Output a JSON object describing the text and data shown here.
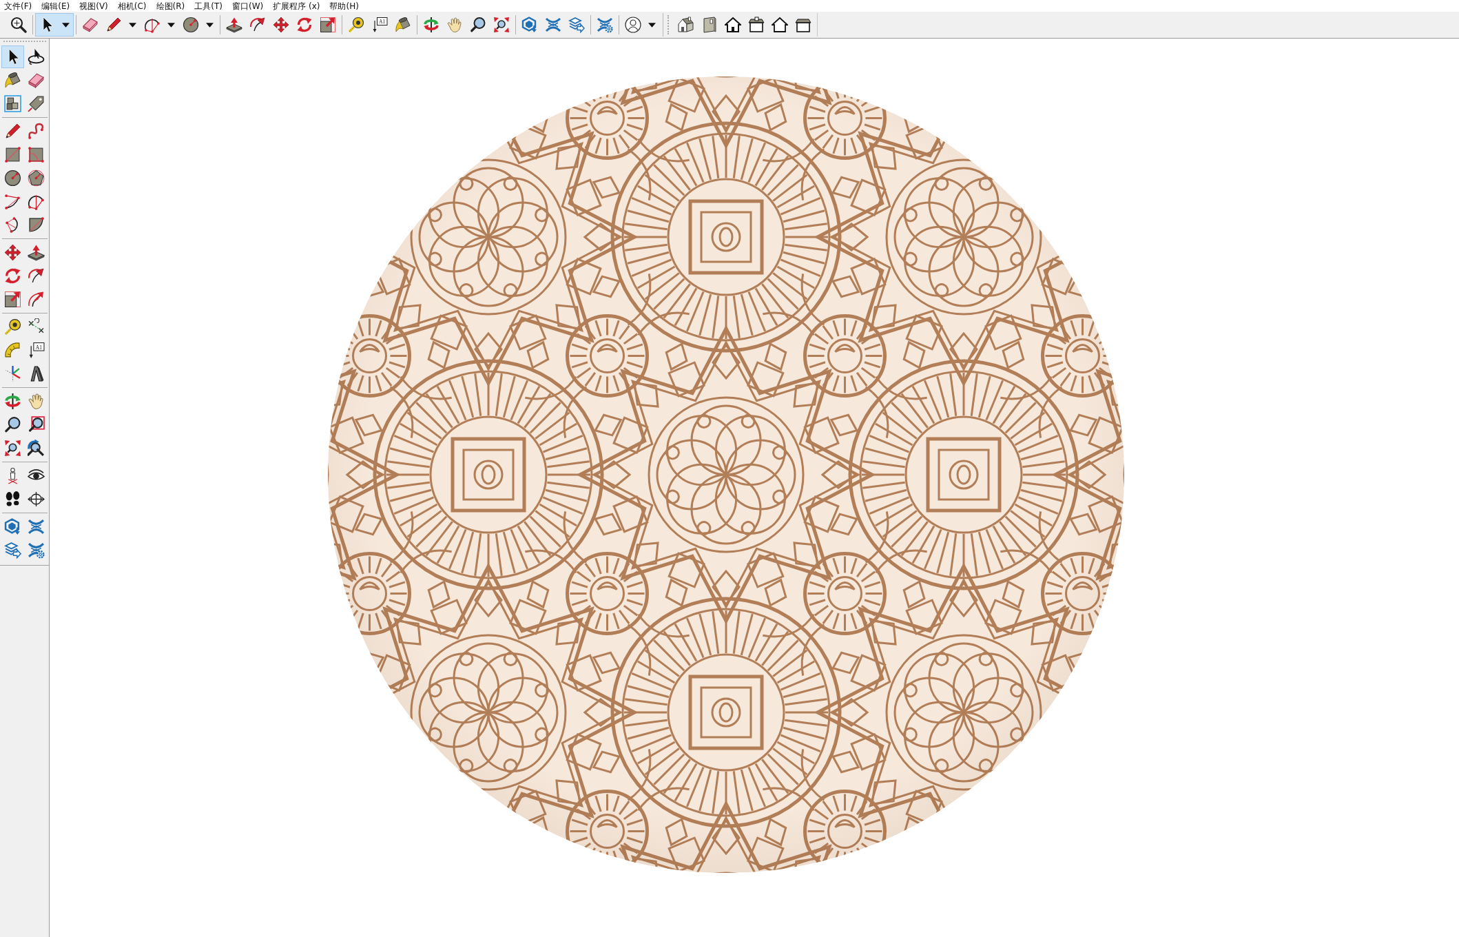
{
  "menu_bar": [
    "文件(F)",
    "编辑(E)",
    "视图(V)",
    "相机(C)",
    "绘图(R)",
    "工具(T)",
    "窗口(W)",
    "扩展程序 (x)",
    "帮助(H)"
  ],
  "toolbars": [
    {
      "groups": [
        [
          {
            "selected": false,
            "dropdown": false
          }
        ],
        [
          {
            "selected": true,
            "dropdown": true
          }
        ],
        [
          {
            "selected": false,
            "dropdown": false
          },
          {
            "selected": false,
            "dropdown": true
          },
          {
            "selected": false,
            "dropdown": true
          },
          {
            "selected": false,
            "dropdown": true
          }
        ],
        [
          {
            "selected": false,
            "dropdown": false
          },
          {
            "selected": false,
            "dropdown": false
          },
          {
            "selected": false,
            "dropdown": false
          },
          {
            "selected": false,
            "dropdown": false
          },
          {
            "selected": false,
            "dropdown": false
          }
        ],
        [
          {
            "selected": false,
            "dropdown": false
          },
          {
            "selected": false,
            "dropdown": false,
            "icon_text": "A1"
          },
          {
            "selected": false,
            "dropdown": false
          }
        ],
        [
          {
            "selected": false,
            "dropdown": false
          },
          {
            "selected": false,
            "dropdown": false
          },
          {
            "selected": false,
            "dropdown": false
          },
          {
            "selected": false,
            "dropdown": false
          }
        ],
        [
          {
            "selected": false,
            "dropdown": false
          },
          {
            "selected": false,
            "dropdown": false
          },
          {
            "selected": false,
            "dropdown": false
          }
        ],
        [
          {
            "selected": false,
            "dropdown": false
          }
        ],
        [
          {
            "selected": false,
            "dropdown": true
          }
        ]
      ]
    },
    {
      "groups": [
        [
          {
            "selected": false,
            "dropdown": false
          },
          {
            "selected": false,
            "dropdown": false
          },
          {
            "selected": false,
            "dropdown": false
          },
          {
            "selected": false,
            "dropdown": false
          },
          {
            "selected": false,
            "dropdown": false
          },
          {
            "selected": false,
            "dropdown": false
          }
        ]
      ]
    }
  ],
  "left_toolbar": {
    "groups": [
      [
        {
          "selected": true
        },
        {
          "selected": false
        },
        {
          "selected": false
        },
        {
          "selected": false
        },
        {
          "selected": false
        },
        {
          "selected": false
        }
      ],
      [
        {
          "selected": false
        },
        {
          "selected": false
        },
        {
          "selected": false
        },
        {
          "selected": false
        },
        {
          "selected": false
        },
        {
          "selected": false
        },
        {
          "selected": false
        },
        {
          "selected": false
        },
        {
          "selected": false
        },
        {
          "selected": false
        }
      ],
      [
        {
          "selected": false
        },
        {
          "selected": false
        },
        {
          "selected": false
        },
        {
          "selected": false
        },
        {
          "selected": false
        },
        {
          "selected": false
        }
      ],
      [
        {
          "selected": false
        },
        {
          "selected": false
        },
        {
          "selected": false
        },
        {
          "selected": false,
          "icon_text": "A1"
        },
        {
          "selected": false
        },
        {
          "selected": false
        }
      ],
      [
        {
          "selected": false
        },
        {
          "selected": false
        },
        {
          "selected": false
        },
        {
          "selected": false
        },
        {
          "selected": false
        },
        {
          "selected": false
        }
      ],
      [
        {
          "selected": false
        },
        {
          "selected": false
        },
        {
          "selected": false
        },
        {
          "selected": false
        }
      ],
      [
        {
          "selected": false
        },
        {
          "selected": false
        },
        {
          "selected": false
        },
        {
          "selected": false
        }
      ]
    ]
  }
}
